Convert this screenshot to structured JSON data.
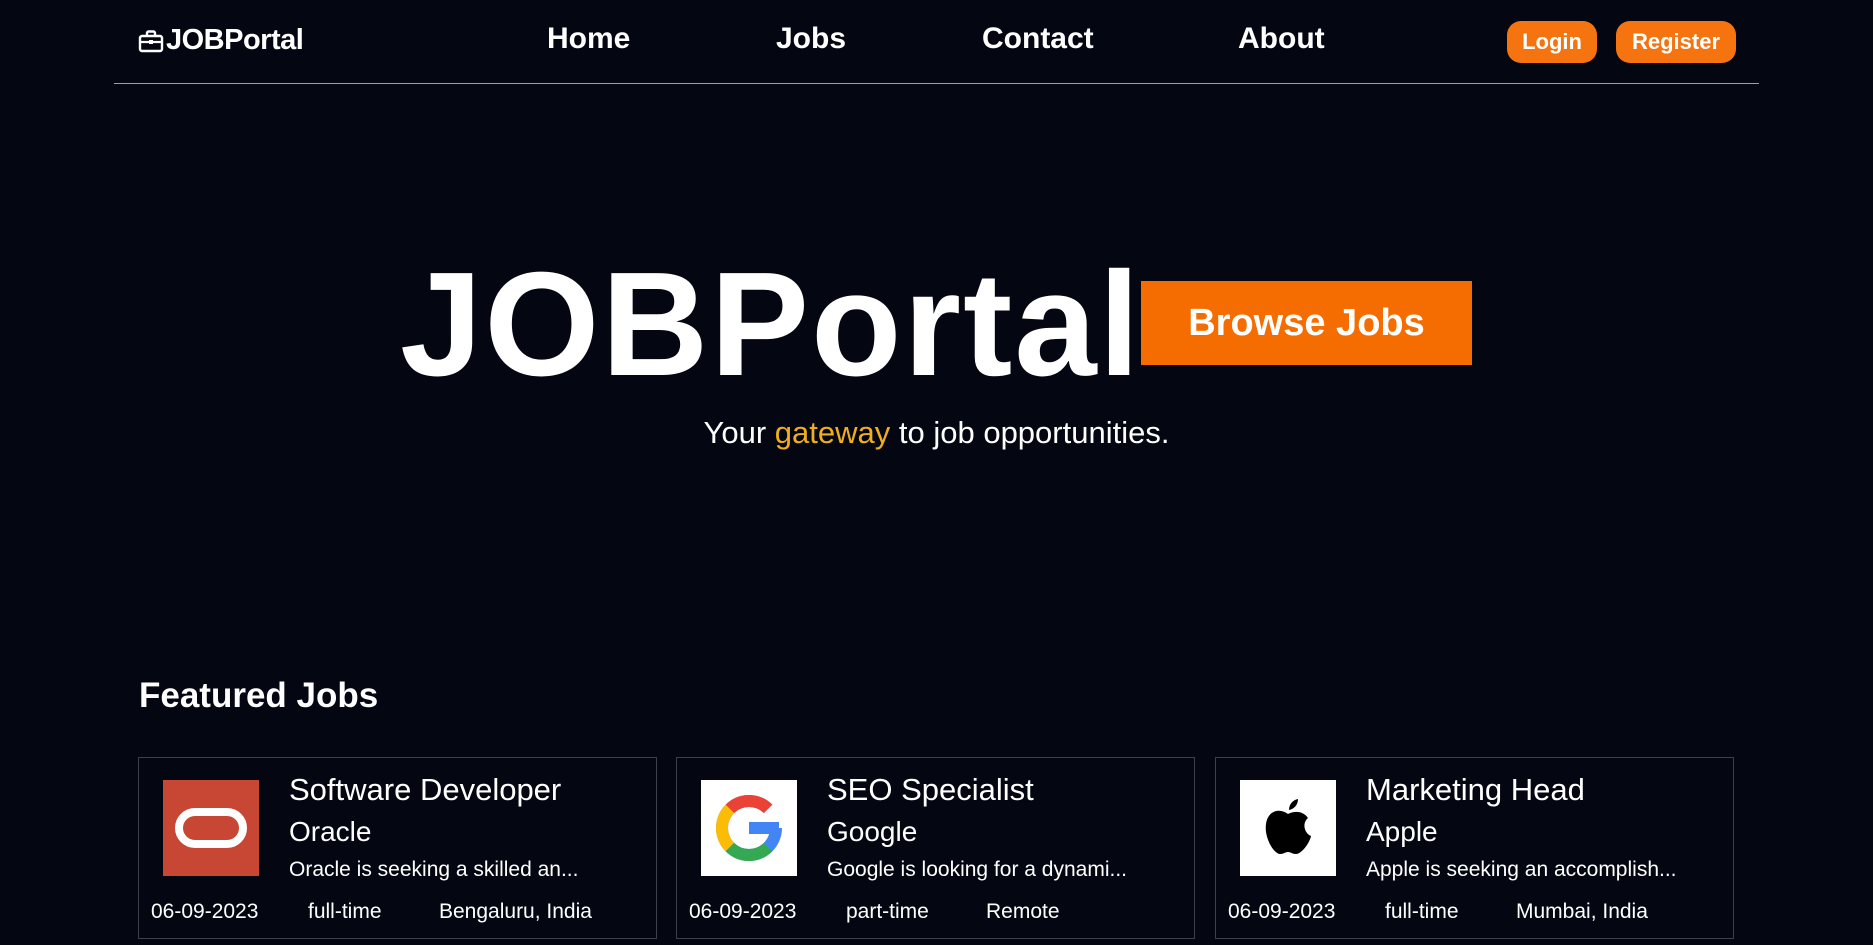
{
  "header": {
    "brand": "JOBPortal",
    "brand_icon": "briefcase-icon",
    "nav": [
      {
        "label": "Home"
      },
      {
        "label": "Jobs"
      },
      {
        "label": "Contact"
      },
      {
        "label": "About"
      }
    ],
    "login_label": "Login",
    "register_label": "Register"
  },
  "hero": {
    "title": "JOBPortal",
    "browse_label": "Browse Jobs",
    "tagline_before": "Your ",
    "tagline_accent": "gateway",
    "tagline_after": " to job opportunities."
  },
  "featured": {
    "title": "Featured Jobs",
    "jobs": [
      {
        "title": "Software Developer",
        "company": "Oracle",
        "description": "Oracle is seeking a skilled an...",
        "date": "06-09-2023",
        "type": "full-time",
        "location": "Bengaluru, India",
        "logo": "oracle-logo"
      },
      {
        "title": "SEO Specialist",
        "company": "Google",
        "description": "Google is looking for a dynami...",
        "date": "06-09-2023",
        "type": "part-time",
        "location": "Remote",
        "logo": "google-logo"
      },
      {
        "title": "Marketing Head",
        "company": "Apple",
        "description": "Apple is seeking an accomplish...",
        "date": "06-09-2023",
        "type": "full-time",
        "location": "Mumbai, India",
        "logo": "apple-logo"
      }
    ]
  },
  "colors": {
    "background": "#040712",
    "accent": "#f57410",
    "highlight": "#f0ad1e"
  }
}
